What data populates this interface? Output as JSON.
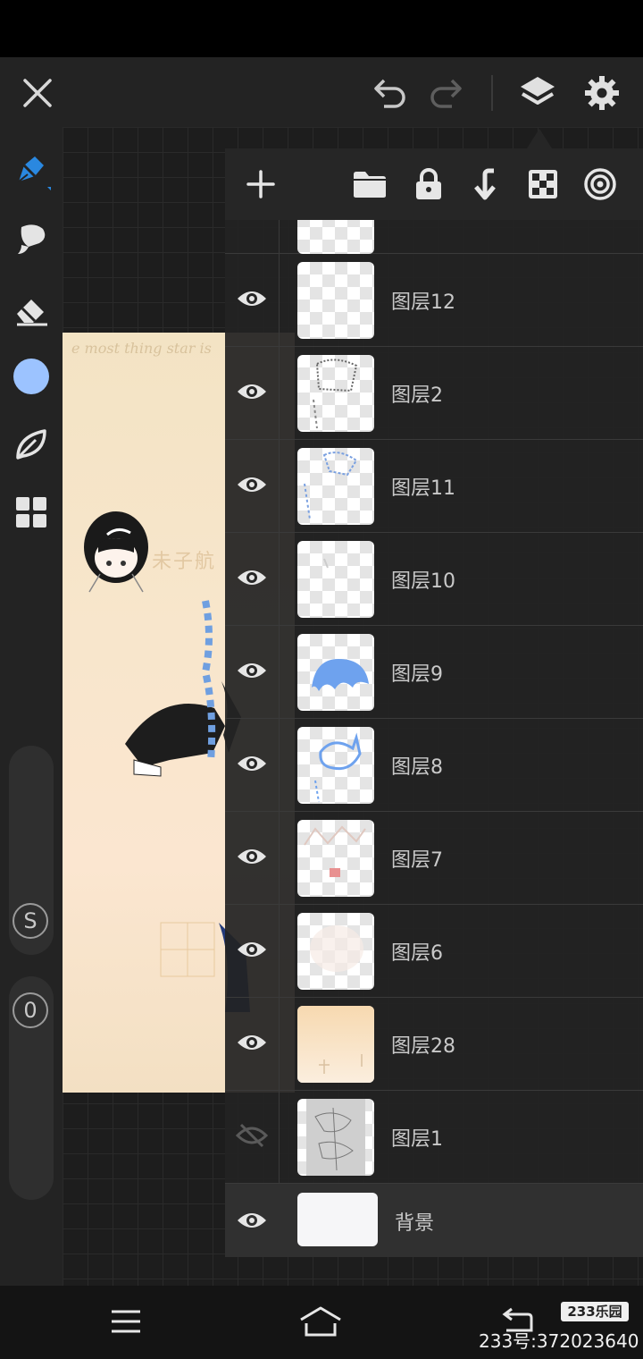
{
  "toolbar": {
    "close": "close-icon",
    "undo": "undo-icon",
    "redo": "redo-icon",
    "layers": "layers-icon",
    "settings": "gear-icon"
  },
  "tools": [
    "pen-icon",
    "smudge-icon",
    "eraser-icon",
    "color-swatch",
    "leaf-icon",
    "grid-icon"
  ],
  "colors": {
    "current": "#9cc3ff",
    "accent": "#2a88e0"
  },
  "sliders": {
    "size_badge": "S",
    "opacity_badge": "0"
  },
  "canvas": {
    "overlay_text": "e most thing star is",
    "cn_text": "未子航"
  },
  "layer_panel": {
    "toolbar": [
      "add-icon",
      "folder-icon",
      "lock-icon",
      "merge-down-icon",
      "transparency-icon",
      "target-icon"
    ],
    "layers": [
      {
        "name": "图层12",
        "visible": true
      },
      {
        "name": "图层2",
        "visible": true
      },
      {
        "name": "图层11",
        "visible": true
      },
      {
        "name": "图层10",
        "visible": true
      },
      {
        "name": "图层9",
        "visible": true
      },
      {
        "name": "图层8",
        "visible": true
      },
      {
        "name": "图层7",
        "visible": true
      },
      {
        "name": "图层6",
        "visible": true
      },
      {
        "name": "图层28",
        "visible": true
      },
      {
        "name": "图层1",
        "visible": false
      }
    ],
    "background": {
      "name": "背景",
      "visible": true
    }
  },
  "navbar": [
    "menu-icon",
    "home-icon",
    "back-icon"
  ],
  "watermark": {
    "logo": "233乐园",
    "id": "233号:372023640"
  }
}
